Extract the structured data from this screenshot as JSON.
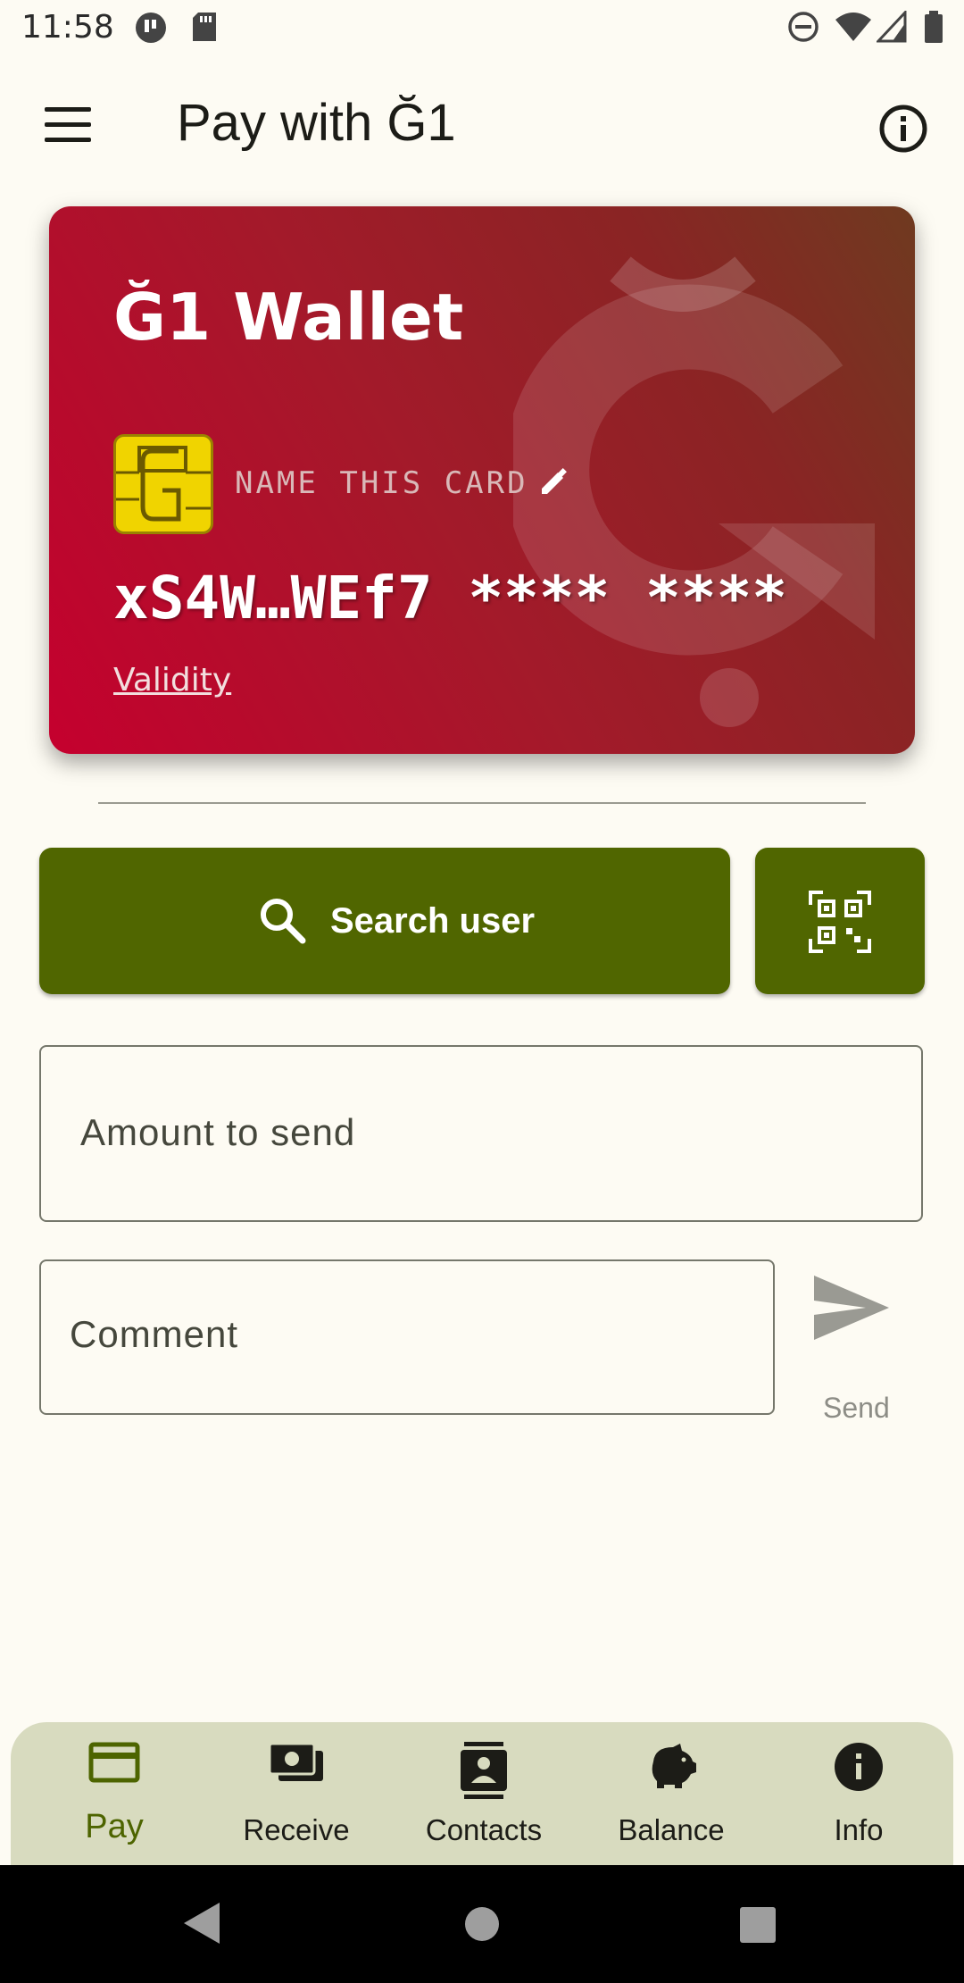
{
  "status_bar": {
    "time": "11:58",
    "icons": [
      "app-notification-icon",
      "sd-card-icon",
      "do-not-disturb-icon",
      "wifi-icon",
      "signal-icon",
      "battery-icon"
    ]
  },
  "app_bar": {
    "title": "Pay with Ğ1",
    "menu_icon": "menu-icon",
    "info_icon": "info-outline-icon"
  },
  "card": {
    "name": "Ğ1 Wallet",
    "label": "NAME THIS CARD",
    "number": "xS4W…WEf7 **** ****",
    "validity": "Validity",
    "colors": {
      "gradient_start": "#c5002e",
      "gradient_end": "#6f3a20",
      "chip": "#f0d400"
    }
  },
  "actions": {
    "search_label": "Search user",
    "search_icon": "search-icon",
    "qr_icon": "qr-scan-icon"
  },
  "form": {
    "amount_placeholder": "Amount to send",
    "comment_placeholder": "Comment",
    "send_label": "Send"
  },
  "bottom_nav": {
    "items": [
      {
        "label": "Pay",
        "icon": "credit-card-icon",
        "active": true
      },
      {
        "label": "Receive",
        "icon": "money-icon",
        "active": false
      },
      {
        "label": "Contacts",
        "icon": "contacts-icon",
        "active": false
      },
      {
        "label": "Balance",
        "icon": "piggy-bank-icon",
        "active": false
      },
      {
        "label": "Info",
        "icon": "info-icon",
        "active": false
      }
    ]
  },
  "theme": {
    "accent": "#506600",
    "background": "#fdfbf3",
    "nav_background": "#d8dbbf"
  }
}
